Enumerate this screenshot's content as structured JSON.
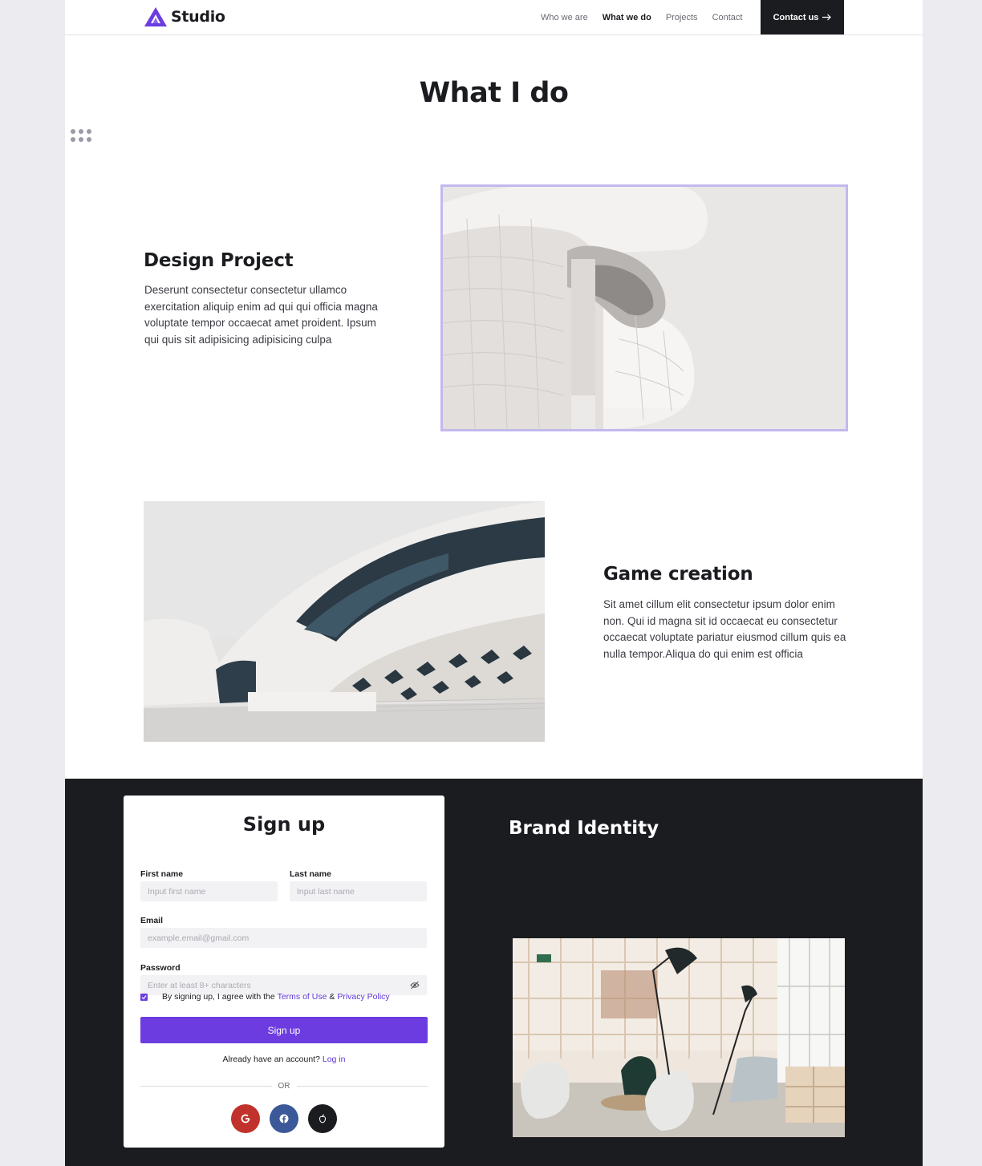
{
  "header": {
    "logo_text": "Studio",
    "nav": [
      {
        "label": "Who we are",
        "active": false
      },
      {
        "label": "What we do",
        "active": true
      },
      {
        "label": "Projects",
        "active": false
      },
      {
        "label": "Contact",
        "active": false
      }
    ],
    "cta_label": "Contact us"
  },
  "hero": {
    "title": "What I do"
  },
  "features": [
    {
      "title": "Design Project",
      "text": "Deserunt consectetur consectetur ullamco exercitation aliquip enim ad qui qui officia magna voluptate tempor occaecat amet proident. Ipsum qui quis sit adipisicing adipisicing culpa"
    },
    {
      "title": "Game creation",
      "text": "Sit amet cillum elit consectetur ipsum dolor enim non. Qui id magna sit id occaecat eu consectetur occaecat voluptate pariatur eiusmod cillum quis ea nulla tempor.Aliqua do qui enim est officia"
    }
  ],
  "signup": {
    "title": "Sign up",
    "first_name_label": "First name",
    "first_name_placeholder": "Input first name",
    "last_name_label": "Last name",
    "last_name_placeholder": "Input last name",
    "email_label": "Email",
    "email_placeholder": "example.email@gmail.com",
    "password_label": "Password",
    "password_placeholder": "Enter at least 8+ characters",
    "agree_prefix": "By signing up, I agree with the",
    "terms_link": "Terms of Use",
    "amp": "&",
    "privacy_link": "Privacy Policy",
    "button_label": "Sign up",
    "have_account": "Already have an account?",
    "login_link": "Log in",
    "or_text": "OR"
  },
  "brand": {
    "title": "Brand Identity"
  },
  "colors": {
    "accent": "#6c3ce0",
    "dark": "#1b1c20",
    "frame": "#c3b8ee",
    "google": "#c0322b",
    "facebook": "#3b5998",
    "apple": "#1b1c20"
  }
}
